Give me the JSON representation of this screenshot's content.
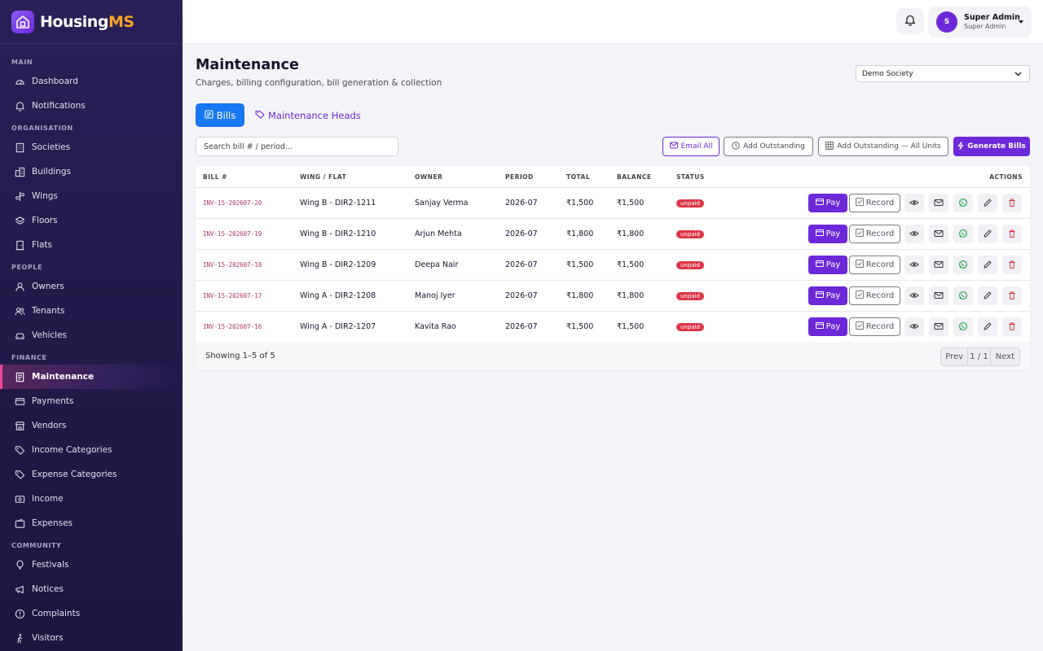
{
  "app": {
    "name_main": "Housing",
    "name_accent": "MS"
  },
  "sidebar": {
    "sections": [
      {
        "label": "MAIN",
        "items": [
          {
            "label": "Dashboard",
            "icon": "dashboard-icon"
          },
          {
            "label": "Notifications",
            "icon": "bell-icon"
          }
        ]
      },
      {
        "label": "ORGANISATION",
        "items": [
          {
            "label": "Societies",
            "icon": "building-icon"
          },
          {
            "label": "Buildings",
            "icon": "buildings-icon"
          },
          {
            "label": "Wings",
            "icon": "signpost-icon"
          },
          {
            "label": "Floors",
            "icon": "layers-icon"
          },
          {
            "label": "Flats",
            "icon": "door-icon"
          }
        ]
      },
      {
        "label": "PEOPLE",
        "items": [
          {
            "label": "Owners",
            "icon": "user-icon"
          },
          {
            "label": "Tenants",
            "icon": "users-icon"
          },
          {
            "label": "Vehicles",
            "icon": "car-icon"
          }
        ]
      },
      {
        "label": "FINANCE",
        "items": [
          {
            "label": "Maintenance",
            "icon": "receipt-icon",
            "active": true
          },
          {
            "label": "Payments",
            "icon": "credit-card-icon"
          },
          {
            "label": "Vendors",
            "icon": "shop-icon"
          },
          {
            "label": "Income Categories",
            "icon": "tag-icon"
          },
          {
            "label": "Expense Categories",
            "icon": "tag-icon"
          },
          {
            "label": "Income",
            "icon": "cash-in-icon"
          },
          {
            "label": "Expenses",
            "icon": "wallet-icon"
          }
        ]
      },
      {
        "label": "COMMUNITY",
        "items": [
          {
            "label": "Festivals",
            "icon": "balloon-icon"
          },
          {
            "label": "Notices",
            "icon": "megaphone-icon"
          },
          {
            "label": "Complaints",
            "icon": "alert-icon"
          },
          {
            "label": "Visitors",
            "icon": "person-walking-icon"
          }
        ]
      }
    ]
  },
  "topbar": {
    "user_initial": "S",
    "user_name": "Super Admin",
    "user_role": "Super Admin"
  },
  "page": {
    "title": "Maintenance",
    "subtitle": "Charges, billing configuration, bill generation & collection",
    "society_selected": "Demo Society"
  },
  "tabs": {
    "bills": "Bills",
    "heads": "Maintenance Heads"
  },
  "toolbar": {
    "search_placeholder": "Search bill # / period...",
    "email_all": "Email All",
    "add_outstanding": "Add Outstanding",
    "add_outstanding_all": "Add Outstanding — All Units",
    "generate_bills": "Generate Bills"
  },
  "table": {
    "columns": [
      "BILL #",
      "WING / FLAT",
      "OWNER",
      "PERIOD",
      "TOTAL",
      "BALANCE",
      "STATUS",
      "ACTIONS"
    ],
    "rows": [
      {
        "bill": "INV-15-202607-20",
        "flat": "Wing B - DIR2-1211",
        "owner": "Sanjay Verma",
        "period": "2026-07",
        "total": "₹1,500",
        "balance": "₹1,500",
        "status": "unpaid"
      },
      {
        "bill": "INV-15-202607-19",
        "flat": "Wing B - DIR2-1210",
        "owner": "Arjun Mehta",
        "period": "2026-07",
        "total": "₹1,800",
        "balance": "₹1,800",
        "status": "unpaid"
      },
      {
        "bill": "INV-15-202607-18",
        "flat": "Wing B - DIR2-1209",
        "owner": "Deepa Nair",
        "period": "2026-07",
        "total": "₹1,500",
        "balance": "₹1,500",
        "status": "unpaid"
      },
      {
        "bill": "INV-15-202607-17",
        "flat": "Wing A - DIR2-1208",
        "owner": "Manoj Iyer",
        "period": "2026-07",
        "total": "₹1,800",
        "balance": "₹1,800",
        "status": "unpaid"
      },
      {
        "bill": "INV-15-202607-16",
        "flat": "Wing A - DIR2-1207",
        "owner": "Kavita Rao",
        "period": "2026-07",
        "total": "₹1,500",
        "balance": "₹1,500",
        "status": "unpaid"
      }
    ],
    "actions": {
      "pay": "Pay",
      "record": "Record"
    }
  },
  "pagination": {
    "showing": "Showing 1–5 of 5",
    "prev": "Prev",
    "page": "1 / 1",
    "next": "Next"
  },
  "colors": {
    "primary": "#6d28d9",
    "blue": "#1877f2",
    "danger": "#dc3545",
    "sidebar": "#2a1f57",
    "accent": "#f5a524"
  }
}
